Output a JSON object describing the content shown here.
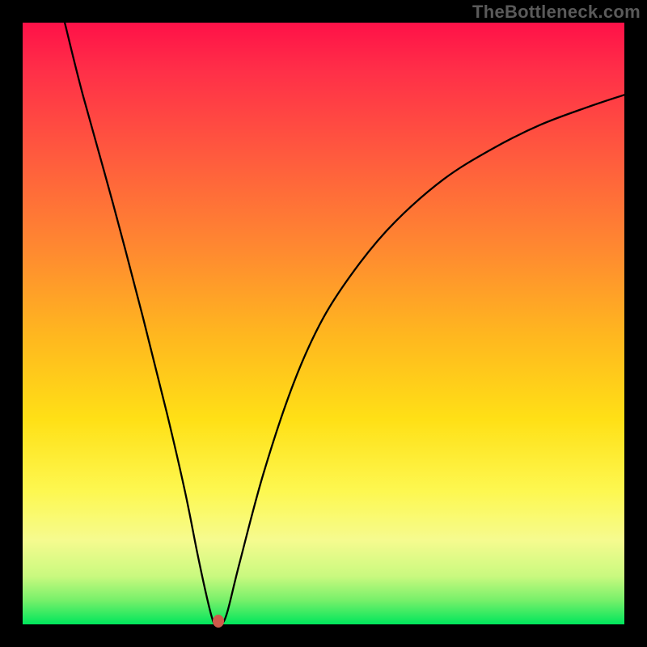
{
  "attribution": "TheBottleneck.com",
  "colors": {
    "frame_bg": "#000000",
    "gradient_top": "#ff1148",
    "gradient_bottom": "#00e65c",
    "curve": "#000000",
    "marker": "#cf5a4b"
  },
  "chart_data": {
    "type": "line",
    "title": "",
    "xlabel": "",
    "ylabel": "",
    "xlim": [
      0,
      100
    ],
    "ylim": [
      0,
      100
    ],
    "grid": false,
    "legend": false,
    "series": [
      {
        "name": "bottleneck-curve",
        "x": [
          7,
          10,
          15,
          20,
          24,
          27,
          29,
          30.5,
          31.5,
          32,
          33,
          34,
          36,
          40,
          45,
          50,
          56,
          62,
          70,
          78,
          86,
          94,
          100
        ],
        "y": [
          100,
          88,
          70,
          51,
          35,
          22,
          12,
          5,
          1,
          0,
          0,
          2,
          10,
          25,
          40,
          51,
          60,
          67,
          74,
          79,
          83,
          86,
          88
        ]
      }
    ],
    "marker": {
      "x": 32.5,
      "y": 0
    }
  }
}
